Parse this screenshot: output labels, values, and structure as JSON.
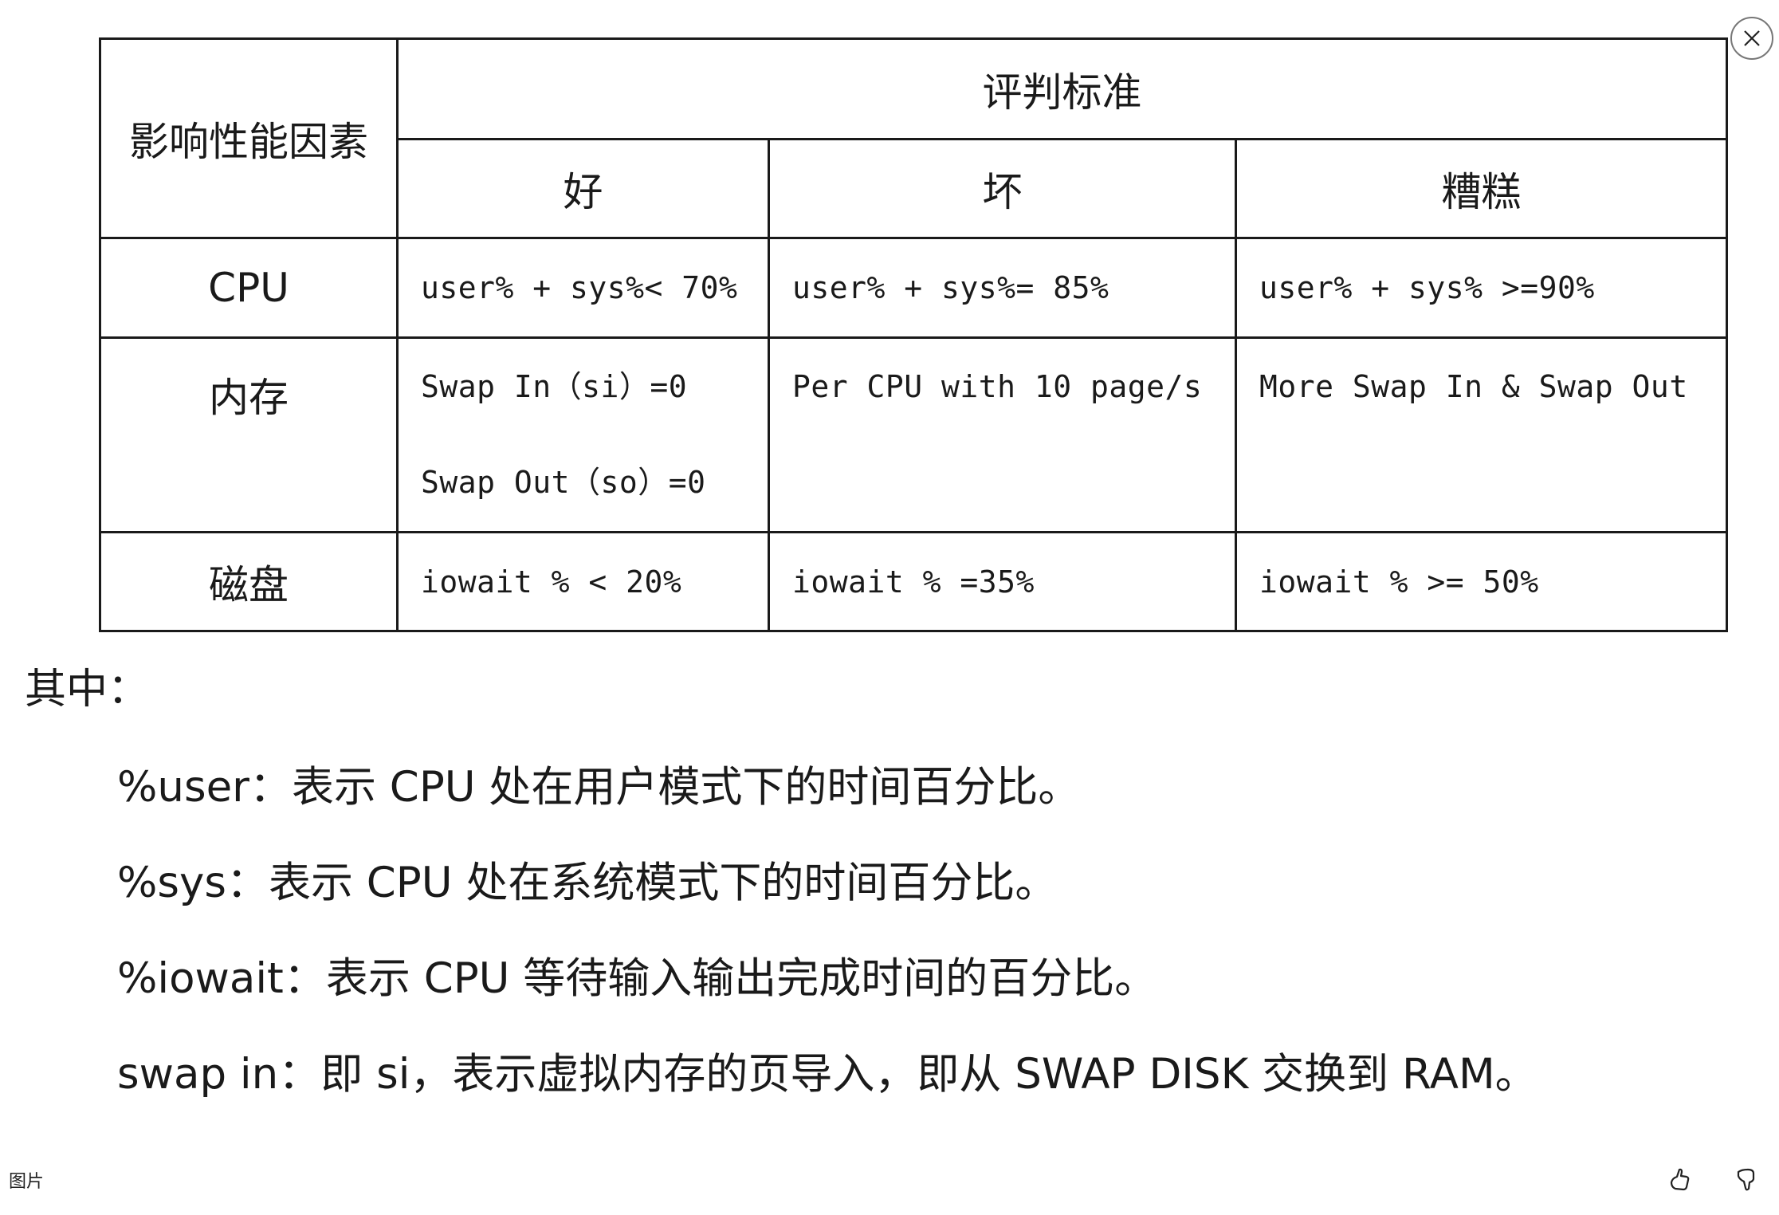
{
  "table": {
    "factor_header": "影响性能因素",
    "criteria_header": "评判标准",
    "levels": [
      "好",
      "坏",
      "糟糕"
    ],
    "rows": [
      {
        "factor": "CPU",
        "good": [
          "user% + sys%< 70%"
        ],
        "bad": [
          "user% + sys%= 85%"
        ],
        "terrible": [
          "user% + sys% >=90%"
        ]
      },
      {
        "factor": "内存",
        "good": [
          "Swap In（si）=0",
          "Swap Out（so）=0"
        ],
        "bad": [
          "Per CPU with 10 page/s"
        ],
        "terrible": [
          "More Swap In & Swap Out"
        ]
      },
      {
        "factor": "磁盘",
        "good": [
          "iowait % < 20%"
        ],
        "bad": [
          "iowait % =35%"
        ],
        "terrible": [
          "iowait % >= 50%"
        ]
      }
    ]
  },
  "notes": {
    "title": "其中：",
    "lines": [
      "%user：表示 CPU 处在用户模式下的时间百分比。",
      "%sys：表示 CPU 处在系统模式下的时间百分比。",
      "%iowait：表示 CPU 等待输入输出完成时间的百分比。",
      "swap in：即 si，表示虚拟内存的页导入，即从 SWAP DISK 交换到 RAM。"
    ]
  },
  "viewer": {
    "close_icon": "close-icon",
    "footer_label": "图片",
    "like_icon": "thumbs-up-icon",
    "dislike_icon": "thumbs-down-icon"
  }
}
